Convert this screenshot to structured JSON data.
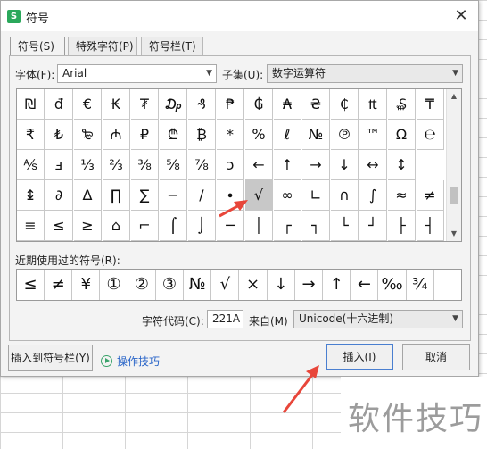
{
  "window": {
    "title": "符号",
    "app_icon_letter": "S",
    "close_glyph": "✕"
  },
  "tabs": [
    {
      "label": "符号(S)"
    },
    {
      "label": "特殊字符(P)"
    },
    {
      "label": "符号栏(T)"
    }
  ],
  "font": {
    "label": "字体(F):",
    "value": "Arial"
  },
  "subset": {
    "label": "子集(U):",
    "value": "数字运算符"
  },
  "symbol_grid": {
    "rows": [
      [
        "₪",
        "đ",
        "€",
        "₭",
        "₮",
        "₯",
        "₰",
        "₱",
        "₲",
        "₳",
        "₴",
        "₵",
        "₶",
        "₷",
        "₸"
      ],
      [
        "₹",
        "₺",
        "₻",
        "₼",
        "₽",
        "₾",
        "₿",
        "*",
        "%",
        "ℓ",
        "№",
        "℗",
        "™",
        "Ω",
        "℮"
      ],
      [
        "⅍",
        "ⅎ",
        "⅓",
        "⅔",
        "⅜",
        "⅝",
        "⅞",
        "ↄ",
        "←",
        "↑",
        "→",
        "↓",
        "↔",
        "↕"
      ],
      [
        "↨",
        "∂",
        "∆",
        "∏",
        "∑",
        "−",
        "∕",
        "∙",
        "√",
        "∞",
        "∟",
        "∩",
        "∫",
        "≈",
        "≠"
      ],
      [
        "≡",
        "≤",
        "≥",
        "⌂",
        "⌐",
        "⌠",
        "⌡",
        "─",
        "│",
        "┌",
        "┐",
        "└",
        "┘",
        "├",
        "┤"
      ]
    ],
    "selected": "√"
  },
  "recent": {
    "label": "近期使用过的符号(R):",
    "symbols": [
      "≤",
      "≠",
      "¥",
      "①",
      "②",
      "③",
      "№",
      "√",
      "×",
      "↓",
      "→",
      "↑",
      "←",
      "‰",
      "¾"
    ]
  },
  "char_code": {
    "label": "字符代码(C):",
    "value": "221A"
  },
  "from": {
    "label": "来自(M)",
    "value": "Unicode(十六进制)"
  },
  "buttons": {
    "insert_to_bar": "插入到符号栏(Y)",
    "tips": "操作技巧",
    "insert": "插入(I)",
    "cancel": "取消"
  },
  "watermark": "软件技巧",
  "colors": {
    "accent": "#4a7fd0",
    "annotation_arrow": "#e8463a",
    "tips_link": "#2b66c8",
    "app_icon": "#2aa85b"
  }
}
